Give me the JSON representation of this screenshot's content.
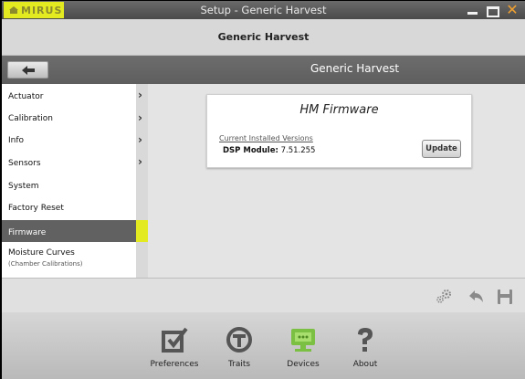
{
  "window": {
    "logo_text": "MIRUS",
    "title": "Setup - Generic Harvest",
    "minimize_icon": "minimize-icon",
    "maximize_icon": "maximize-icon",
    "close_label": "✕"
  },
  "header": {
    "title": "Generic Harvest"
  },
  "navbar": {
    "title": "Generic Harvest",
    "back_icon": "back-arrow-icon"
  },
  "sidebar": {
    "items": [
      {
        "label": "Actuator",
        "has_chevron": true
      },
      {
        "label": "Calibration",
        "has_chevron": true
      },
      {
        "label": "Info",
        "has_chevron": true
      },
      {
        "label": "Sensors",
        "has_chevron": true
      },
      {
        "label": "System",
        "has_chevron": false
      },
      {
        "label": "Factory Reset",
        "has_chevron": false
      },
      {
        "label": "Firmware",
        "has_chevron": false,
        "active": true
      },
      {
        "label": "Moisture Curves",
        "sublabel": "(Chamber Calibrations)",
        "has_chevron": false
      }
    ],
    "chevron_glyph": "›"
  },
  "card": {
    "title": "HM Firmware",
    "section_label": "Current Installed Versions",
    "dsp_label": "DSP Module:",
    "dsp_value": "7.51.255",
    "update_label": "Update"
  },
  "toolbar": {
    "icons": [
      "settings-gears-icon",
      "undo-icon",
      "save-icon"
    ]
  },
  "bottom_nav": {
    "items": [
      {
        "label": "Preferences",
        "icon": "checkbox-icon"
      },
      {
        "label": "Traits",
        "icon": "traits-t-icon"
      },
      {
        "label": "Devices",
        "icon": "monitor-icon",
        "active": true
      },
      {
        "label": "About",
        "icon": "question-icon"
      }
    ]
  },
  "colors": {
    "accent": "#e3ea1f",
    "active_device_green": "#7bc043",
    "active_sidebar": "#616161"
  }
}
